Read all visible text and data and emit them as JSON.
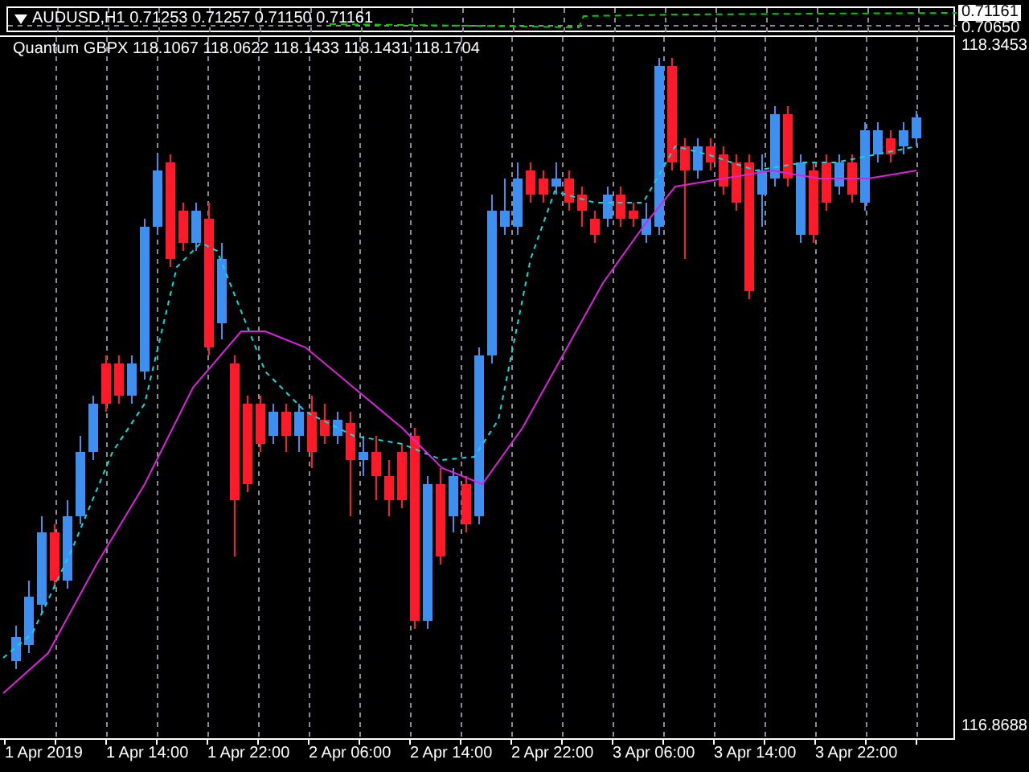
{
  "indicator_window": {
    "title": "AUDUSD,H1",
    "prices": "0.71253 0.71257 0.71150 0.71161",
    "axis_labels": [
      {
        "text": "0.71161",
        "selected": true
      },
      {
        "text": "0.70650",
        "selected": false
      }
    ]
  },
  "main_chart": {
    "title": "Quantum GBPX 118.1067 118.0622 118.1433 118.1431 118.1704",
    "axis_labels": [
      "118.3453",
      "116.8688"
    ]
  },
  "time_axis": [
    "1 Apr 2019",
    "1 Apr 14:00",
    "1 Apr 22:00",
    "2 Apr 06:00",
    "2 Apr 14:00",
    "2 Apr 22:00",
    "3 Apr 06:00",
    "3 Apr 14:00",
    "3 Apr 22:00"
  ]
}
